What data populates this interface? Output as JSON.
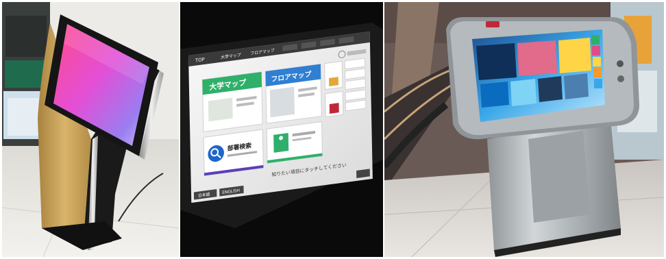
{
  "panels": [
    {
      "name": "kiosk-gold-standing"
    },
    {
      "name": "kiosk-touchscreen-closeup"
    },
    {
      "name": "kiosk-steel-table"
    }
  ],
  "screen2": {
    "nav": [
      "TOP",
      "大学マップ",
      "フロアマップ",
      "",
      "",
      "",
      ""
    ],
    "tiles": {
      "campus_map": "大学マップ",
      "floor_map": "フロアマップ",
      "dept_search": "部署検索",
      "evacuation": ""
    },
    "hint": "知りたい項目にタッチしてください",
    "footer": [
      "日本語",
      "ENGLISH"
    ]
  },
  "colors": {
    "gold": "#c9a35a",
    "steel": "#b8bcbf",
    "tile_green": "#2fb06a",
    "tile_blue": "#2f7fd3",
    "tile_purple": "#5a3fb8",
    "accent_red": "#c0283a"
  }
}
